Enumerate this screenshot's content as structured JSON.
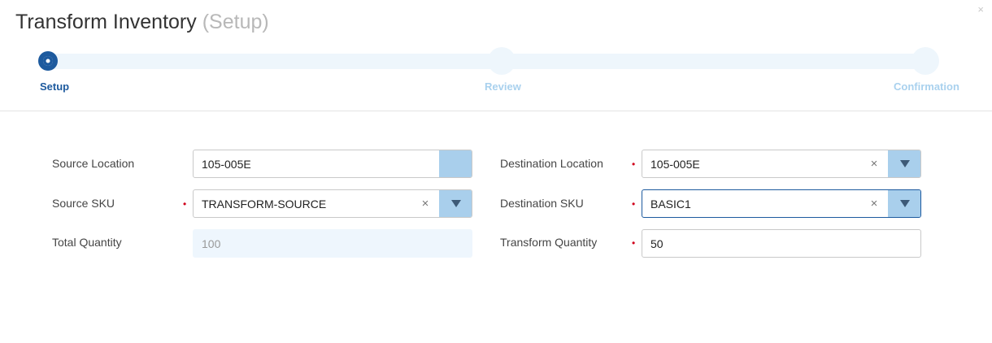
{
  "modal": {
    "title": "Transform Inventory",
    "subtitle": "(Setup)",
    "close_glyph": "×"
  },
  "stepper": {
    "steps": [
      {
        "label": "Setup",
        "state": "active"
      },
      {
        "label": "Review",
        "state": "pending"
      },
      {
        "label": "Confirmation",
        "state": "pending"
      }
    ]
  },
  "form": {
    "required_mark": "•",
    "source_location": {
      "label": "Source Location",
      "value": "105-005E"
    },
    "source_sku": {
      "label": "Source SKU",
      "value": "TRANSFORM-SOURCE",
      "clear_glyph": "×"
    },
    "total_quantity": {
      "label": "Total Quantity",
      "value": "100"
    },
    "destination_location": {
      "label": "Destination Location",
      "value": "105-005E",
      "clear_glyph": "×"
    },
    "destination_sku": {
      "label": "Destination SKU",
      "value": "BASIC1",
      "clear_glyph": "×"
    },
    "transform_quantity": {
      "label": "Transform Quantity",
      "value": "50"
    }
  },
  "colors": {
    "accent": "#1d5a9e",
    "step_pending": "#a9d1ee",
    "dropdown_button": "#a9cfec",
    "required": "#d0021b",
    "readonly_bg": "#eef6fd"
  },
  "icons": {
    "close": "close-icon",
    "clear": "clear-icon",
    "dropdown": "chevron-down-icon"
  }
}
